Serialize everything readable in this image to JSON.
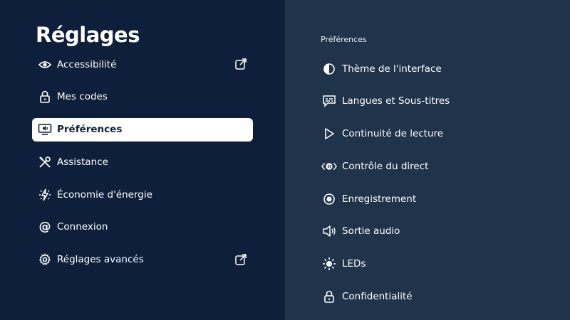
{
  "header": {
    "title": "Réglages"
  },
  "sidebar": {
    "items": [
      {
        "label": "Accessibilité",
        "icon": "eye-icon",
        "external": true
      },
      {
        "label": "Mes codes",
        "icon": "lock-icon"
      },
      {
        "label": "Préférences",
        "icon": "tv-sound-icon",
        "selected": true
      },
      {
        "label": "Assistance",
        "icon": "tools-icon"
      },
      {
        "label": "Économie d'énergie",
        "icon": "energy-icon"
      },
      {
        "label": "Connexion",
        "icon": "at-icon"
      },
      {
        "label": "Réglages avancés",
        "icon": "gear-icon",
        "external": true
      }
    ]
  },
  "panel": {
    "heading": "Préférences",
    "items": [
      {
        "label": "Thème de l'interface",
        "icon": "contrast-icon"
      },
      {
        "label": "Langues et Sous-titres",
        "icon": "subtitles-icon"
      },
      {
        "label": "Continuité de lecture",
        "icon": "play-icon"
      },
      {
        "label": "Contrôle du direct",
        "icon": "live-control-icon"
      },
      {
        "label": "Enregistrement",
        "icon": "record-icon"
      },
      {
        "label": "Sortie audio",
        "icon": "speaker-icon"
      },
      {
        "label": "LEDs",
        "icon": "brightness-icon"
      },
      {
        "label": "Confidentialité",
        "icon": "lock-icon"
      }
    ]
  },
  "colors": {
    "left_bg": "#0d1f3a",
    "right_bg": "#1f334b",
    "selected_bg": "#ffffff",
    "text": "#ffffff"
  }
}
